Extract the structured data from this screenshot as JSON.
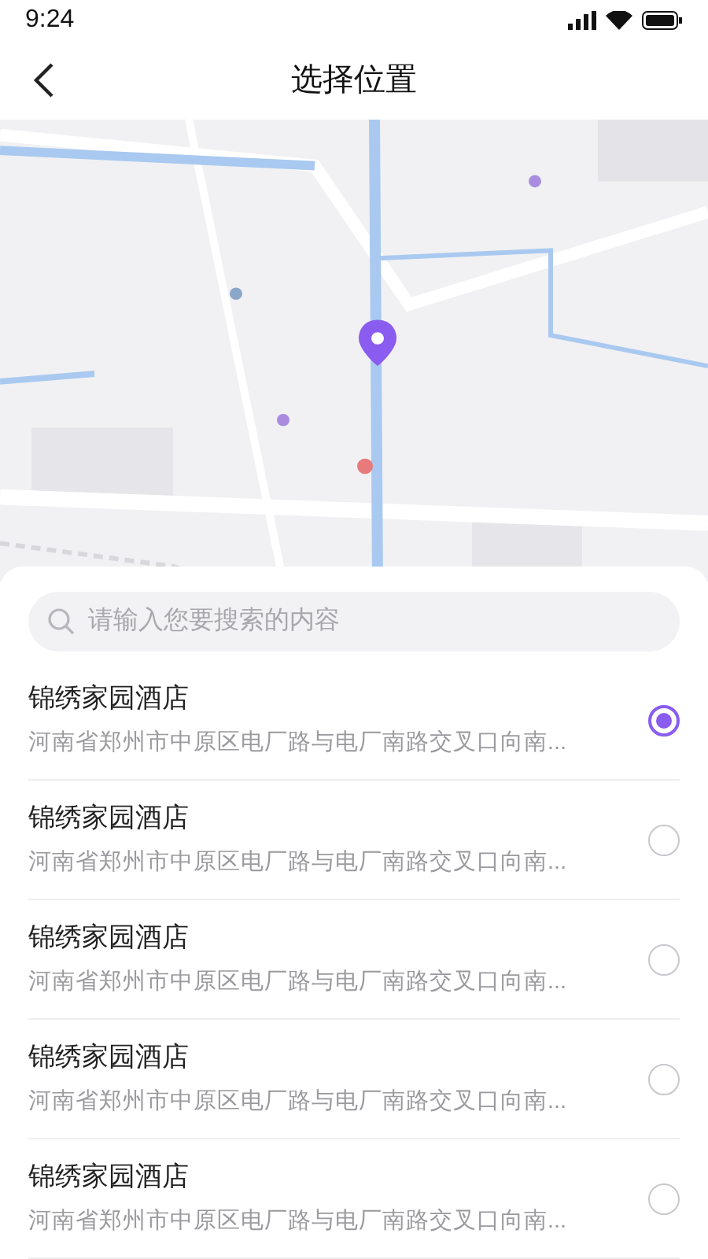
{
  "status_bar": {
    "time": "9:24"
  },
  "header": {
    "title": "选择位置"
  },
  "search": {
    "placeholder": "请输入您要搜索的内容"
  },
  "places": [
    {
      "name": "锦绣家园酒店",
      "address": "河南省郑州市中原区电厂路与电厂南路交叉口向南...",
      "selected": true
    },
    {
      "name": "锦绣家园酒店",
      "address": "河南省郑州市中原区电厂路与电厂南路交叉口向南...",
      "selected": false
    },
    {
      "name": "锦绣家园酒店",
      "address": "河南省郑州市中原区电厂路与电厂南路交叉口向南...",
      "selected": false
    },
    {
      "name": "锦绣家园酒店",
      "address": "河南省郑州市中原区电厂路与电厂南路交叉口向南...",
      "selected": false
    },
    {
      "name": "锦绣家园酒店",
      "address": "河南省郑州市中原区电厂路与电厂南路交叉口向南...",
      "selected": false
    }
  ]
}
